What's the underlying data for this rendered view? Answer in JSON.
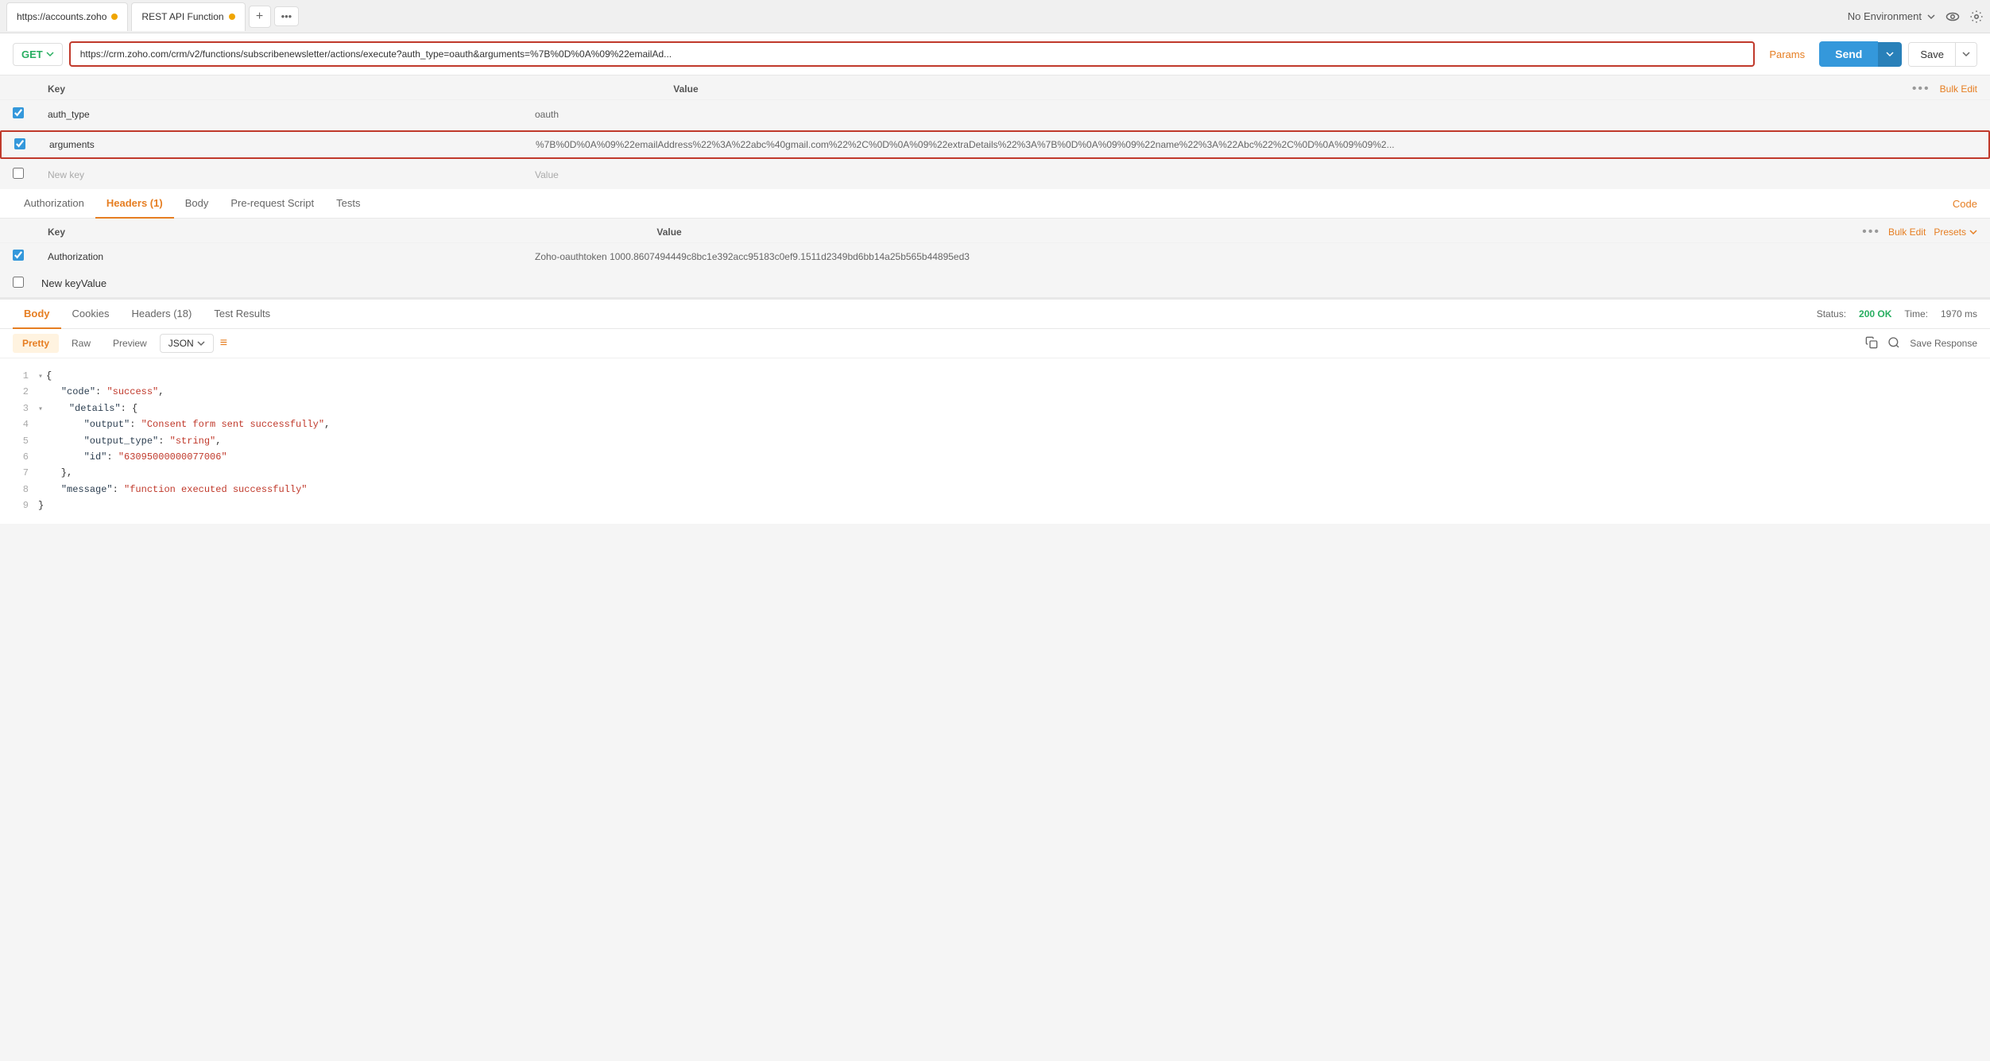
{
  "tabs": {
    "tab1": {
      "label": "https://accounts.zoho",
      "dot": "orange"
    },
    "tab2": {
      "label": "REST API Function",
      "dot": "orange"
    },
    "add": "+",
    "more": "•••"
  },
  "top_right": {
    "env_label": "No Environment",
    "eye_icon": "👁",
    "gear_icon": "⚙"
  },
  "url_bar": {
    "method": "GET",
    "url": "https://crm.zoho.com/crm/v2/functions/subscribenewsletter/actions/execute?auth_type=oauth&arguments=%7B%0D%0A%09%22emailAd...",
    "params_label": "Params",
    "send_label": "Send",
    "save_label": "Save"
  },
  "params_table": {
    "col_key": "Key",
    "col_value": "Value",
    "more_dots": "•••",
    "bulk_edit": "Bulk Edit",
    "rows": [
      {
        "checked": true,
        "key": "auth_type",
        "value": "oauth"
      },
      {
        "checked": true,
        "key": "arguments",
        "value": "%7B%0D%0A%09%22emailAddress%22%3A%22abc%40gmail.com%22%2C%0D%0A%09%22extraDetails%22%3A%7B%0D%0A%09%09%22name%22%3A%22Abc%22%2C%0D%0A%09%09%2..."
      }
    ],
    "new_key": "New key",
    "new_value": "Value"
  },
  "request_tabs": {
    "tabs": [
      {
        "label": "Authorization",
        "active": false
      },
      {
        "label": "Headers (1)",
        "active": true
      },
      {
        "label": "Body",
        "active": false
      },
      {
        "label": "Pre-request Script",
        "active": false
      },
      {
        "label": "Tests",
        "active": false
      }
    ],
    "code_link": "Code"
  },
  "headers_table": {
    "col_key": "Key",
    "col_value": "Value",
    "more_dots": "•••",
    "bulk_edit": "Bulk Edit",
    "presets": "Presets",
    "rows": [
      {
        "checked": true,
        "key": "Authorization",
        "value": "Zoho-oauthtoken 1000.8607494449c8bc1e392acc95183c0ef9.1511d2349bd6bb14a25b565b44895ed3"
      }
    ],
    "new_key": "New key",
    "new_value": "Value"
  },
  "response_section": {
    "tabs": [
      {
        "label": "Body",
        "active": true
      },
      {
        "label": "Cookies",
        "active": false
      },
      {
        "label": "Headers (18)",
        "active": false
      },
      {
        "label": "Test Results",
        "active": false
      }
    ],
    "status_label": "Status:",
    "status_value": "200 OK",
    "time_label": "Time:",
    "time_value": "1970 ms"
  },
  "response_toolbar": {
    "fmt_tabs": [
      {
        "label": "Pretty",
        "active": true
      },
      {
        "label": "Raw",
        "active": false
      },
      {
        "label": "Preview",
        "active": false
      }
    ],
    "format": "JSON",
    "wrap_icon": "≡",
    "save_response": "Save Response"
  },
  "json_content": {
    "lines": [
      {
        "num": 1,
        "content": "{",
        "collapsible": true
      },
      {
        "num": 2,
        "content": "    \"code\": \"success\","
      },
      {
        "num": 3,
        "content": "    \"details\": {",
        "collapsible": true
      },
      {
        "num": 4,
        "content": "        \"output\": \"Consent form sent successfully\","
      },
      {
        "num": 5,
        "content": "        \"output_type\": \"string\","
      },
      {
        "num": 6,
        "content": "        \"id\": \"63095000000077006\""
      },
      {
        "num": 7,
        "content": "    },"
      },
      {
        "num": 8,
        "content": "    \"message\": \"function executed successfully\""
      },
      {
        "num": 9,
        "content": "}"
      }
    ]
  }
}
